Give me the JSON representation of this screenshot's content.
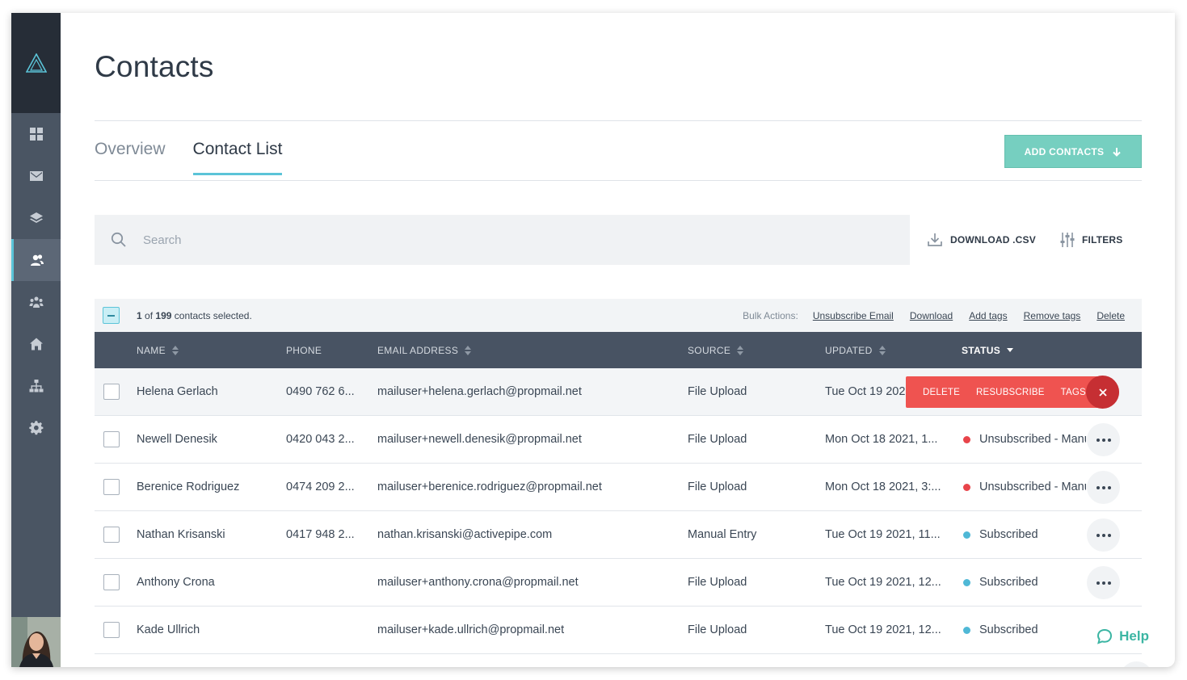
{
  "page": {
    "title": "Contacts"
  },
  "tabs": [
    {
      "label": "Overview",
      "active": false
    },
    {
      "label": "Contact List",
      "active": true
    }
  ],
  "add_contacts": {
    "label": "ADD CONTACTS",
    "icon": "arrow-down-icon"
  },
  "search": {
    "placeholder": "Search",
    "value": ""
  },
  "toolbar": {
    "download_label": "DOWNLOAD .CSV",
    "filters_label": "FILTERS"
  },
  "bulk": {
    "selected_count": "1",
    "of_text": "of",
    "total_count": "199",
    "suffix": "contacts selected.",
    "actions_label": "Bulk Actions:",
    "actions": [
      "Unsubscribe Email",
      "Download",
      "Add tags",
      "Remove tags",
      "Delete"
    ]
  },
  "table": {
    "columns": [
      {
        "label": "NAME",
        "sortable": true
      },
      {
        "label": "PHONE",
        "sortable": false
      },
      {
        "label": "EMAIL ADDRESS",
        "sortable": true
      },
      {
        "label": "SOURCE",
        "sortable": true
      },
      {
        "label": "UPDATED",
        "sortable": true
      },
      {
        "label": "STATUS",
        "sortable": true,
        "active": true
      }
    ],
    "rows": [
      {
        "name": "Helena Gerlach",
        "phone": "0490 762 6...",
        "email": "mailuser+helena.gerlach@propmail.net",
        "source": "File Upload",
        "updated": "Tue Oct 19 2021",
        "status": "",
        "status_color": ""
      },
      {
        "name": "Newell Denesik",
        "phone": "0420 043 2...",
        "email": "mailuser+newell.denesik@propmail.net",
        "source": "File Upload",
        "updated": "Mon Oct 18 2021, 1...",
        "status": "Unsubscribed - Manu",
        "status_color": "#e8444a"
      },
      {
        "name": "Berenice Rodriguez",
        "phone": "0474 209 2...",
        "email": "mailuser+berenice.rodriguez@propmail.net",
        "source": "File Upload",
        "updated": "Mon Oct 18 2021, 3:...",
        "status": "Unsubscribed - Manu",
        "status_color": "#e8444a"
      },
      {
        "name": "Nathan Krisanski",
        "phone": "0417 948 2...",
        "email": "nathan.krisanski@activepipe.com",
        "source": "Manual Entry",
        "updated": "Tue Oct 19 2021, 11...",
        "status": "Subscribed",
        "status_color": "#4fb8d6"
      },
      {
        "name": "Anthony Crona",
        "phone": "",
        "email": "mailuser+anthony.crona@propmail.net",
        "source": "File Upload",
        "updated": "Tue Oct 19 2021, 12...",
        "status": "Subscribed",
        "status_color": "#4fb8d6"
      },
      {
        "name": "Kade Ullrich",
        "phone": "",
        "email": "mailuser+kade.ullrich@propmail.net",
        "source": "File Upload",
        "updated": "Tue Oct 19 2021, 12...",
        "status": "Subscribed",
        "status_color": "#4fb8d6"
      }
    ]
  },
  "row_actions": {
    "delete": "DELETE",
    "resubscribe": "RESUBSCRIBE",
    "tags": "TAGS",
    "close_icon": "close-icon"
  },
  "help": {
    "label": "Help",
    "icon": "chat-bubble-icon"
  },
  "sidebar": {
    "items": [
      {
        "icon": "dashboard-icon"
      },
      {
        "icon": "mail-icon"
      },
      {
        "icon": "layers-icon"
      },
      {
        "icon": "contacts-icon",
        "active": true
      },
      {
        "icon": "team-icon"
      },
      {
        "icon": "home-icon"
      },
      {
        "icon": "org-chart-icon"
      },
      {
        "icon": "gear-icon"
      }
    ]
  },
  "colors": {
    "accent": "#5bc4d8",
    "primary_button": "#76cfc0",
    "danger": "#ef5350",
    "header": "#485363",
    "sidebar": "#4a5563"
  }
}
